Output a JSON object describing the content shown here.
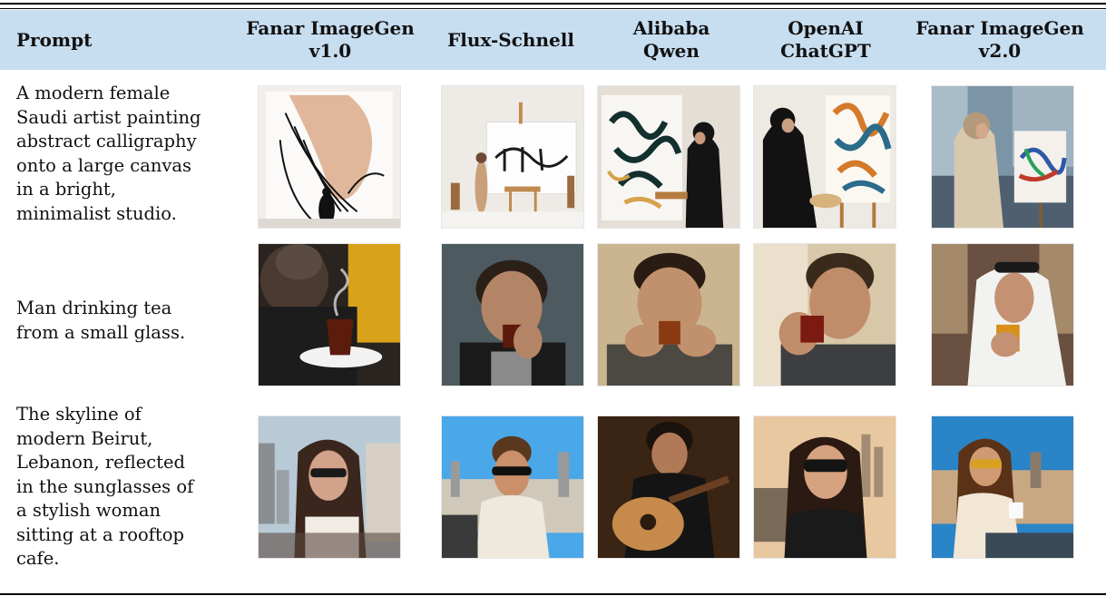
{
  "table": {
    "headers": [
      {
        "line1": "Prompt",
        "line2": ""
      },
      {
        "line1": "Fanar ImageGen",
        "line2": "v1.0"
      },
      {
        "line1": "Flux-Schnell",
        "line2": ""
      },
      {
        "line1": "Alibaba",
        "line2": "Qwen"
      },
      {
        "line1": "OpenAI",
        "line2": "ChatGPT"
      },
      {
        "line1": "Fanar ImageGen",
        "line2": "v2.0"
      }
    ],
    "rows": [
      {
        "prompt_lines": [
          "A modern female",
          "Saudi artist painting",
          "abstract calligraphy",
          "onto a large canvas",
          "in a bright,",
          "minimalist studio."
        ]
      },
      {
        "prompt_lines": [
          "Man drinking tea",
          "from a small glass."
        ]
      },
      {
        "prompt_lines": [
          "The skyline of",
          "modern Beirut,",
          "Lebanon, reflected",
          "in the sunglasses of",
          "a stylish woman",
          "sitting at a rooftop",
          "cafe."
        ]
      }
    ]
  }
}
